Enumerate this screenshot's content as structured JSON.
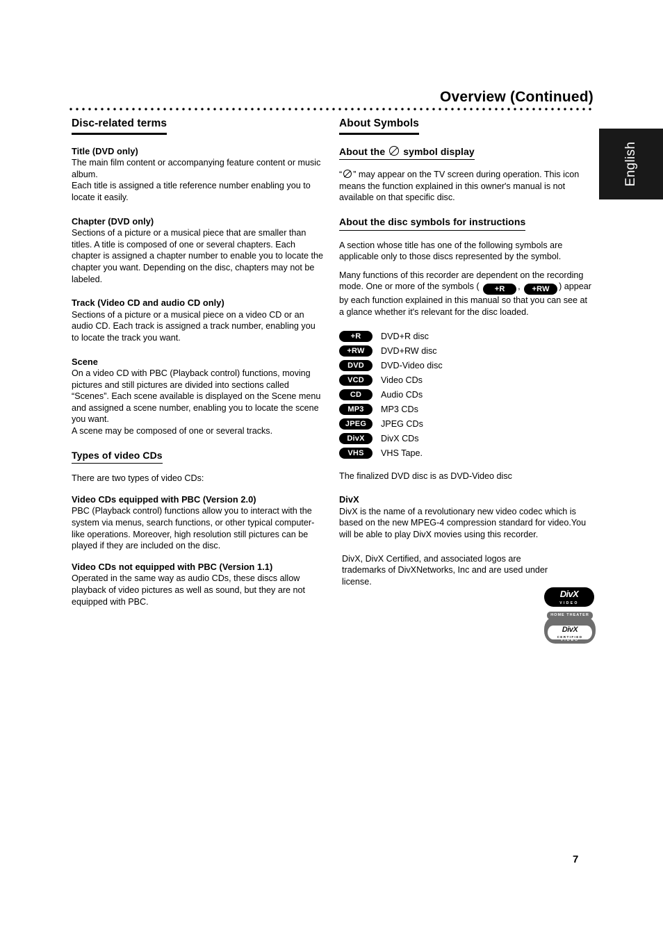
{
  "header": {
    "title": "Overview (Continued)"
  },
  "language_tab": {
    "label": "English"
  },
  "page_number": "7",
  "left_column": {
    "section_title": "Disc-related terms",
    "entries": [
      {
        "heading": "Title (DVD only)",
        "paragraphs": [
          "The main film content or accompanying feature content or music album.",
          "Each title is assigned a title reference number enabling you to locate it easily."
        ]
      },
      {
        "heading": "Chapter (DVD only)",
        "paragraphs": [
          "Sections of a picture or a musical piece that are smaller than titles. A title is composed of one or several chapters. Each chapter is assigned a chapter number to enable you to locate the chapter you want. Depending on the disc, chapters may not be labeled."
        ]
      },
      {
        "heading": "Track (Video CD and audio CD only)",
        "paragraphs": [
          "Sections of a picture or a musical piece on a video CD or an audio CD. Each track is assigned a track number, enabling you to locate the track you want."
        ]
      },
      {
        "heading": "Scene",
        "paragraphs": [
          "On a video CD with PBC (Playback control) functions, moving pictures and still pictures are divided into sections called “Scenes”. Each scene available is displayed on the Scene menu and assigned a scene number, enabling you to locate the scene you want.",
          "A scene may be composed of one or several tracks."
        ]
      }
    ],
    "sub_section_title": "Types of video CDs",
    "sub_section_intro": "There are two types of video CDs:",
    "sub_entries": [
      {
        "heading": "Video CDs equipped with PBC (Version 2.0)",
        "paragraphs": [
          "PBC (Playback control) functions allow you to interact with the system via menus, search functions, or other typical computer-like operations. Moreover, high resolution still pictures can be played if they are included on the disc."
        ]
      },
      {
        "heading": "Video CDs not equipped with PBC (Version 1.1)",
        "paragraphs": [
          "Operated in the same way as audio CDs, these discs allow playback of video pictures as well as sound, but they are not equipped with PBC."
        ]
      }
    ]
  },
  "right_column": {
    "section_title": "About Symbols",
    "symbol_display": {
      "heading_before": "About the",
      "heading_after": "symbol display",
      "paragraph_part1": "“",
      "paragraph_part2": "” may appear on the TV screen during operation. This icon means the function explained in this owner's manual is not available on that specific disc."
    },
    "disc_symbols": {
      "heading": "About the disc symbols for instructions",
      "paragraph1": "A section whose title has one of the following symbols are applicable only to those discs represented by the symbol.",
      "paragraph2_part1": "Many functions of this recorder are dependent on the recording mode. One or more of the symbols",
      "paragraph2_open": "(",
      "paragraph2_badge1": "+R",
      "paragraph2_comma": ",",
      "paragraph2_badge2": "+RW",
      "paragraph2_part2": ") appear by each function explained in this manual so that you can see at a glance whether it's relevant for the disc loaded."
    },
    "legend": [
      {
        "badge": "+R",
        "label": "DVD+R disc"
      },
      {
        "badge": "+RW",
        "label": "DVD+RW disc"
      },
      {
        "badge": "DVD",
        "label": "DVD-Video disc"
      },
      {
        "badge": "VCD",
        "label": "Video CDs"
      },
      {
        "badge": "CD",
        "label": "Audio CDs"
      },
      {
        "badge": "MP3",
        "label": "MP3 CDs"
      },
      {
        "badge": "JPEG",
        "label": "JPEG CDs"
      },
      {
        "badge": "DivX",
        "label": "DivX CDs"
      },
      {
        "badge": "VHS",
        "label": "VHS Tape."
      }
    ],
    "finalized_note": "The finalized DVD disc is as DVD-Video disc",
    "divx": {
      "heading": "DivX",
      "paragraph": "DivX is the name of a revolutionary new video codec which is based on the new MPEG-4 compression standard for video.You will be able to play DivX movies using this recorder.",
      "trademark": "DivX, DivX Certified, and associated logos are trademarks of DivXNetworks, Inc and are used under license."
    },
    "divx_logos": {
      "video_word": "DivX",
      "video_sub": "VIDEO",
      "cert_banner": "HOME THEATER",
      "cert_word": "DivX",
      "cert_certified": "CERTIFIED",
      "cert_video": "VIDEO"
    }
  }
}
